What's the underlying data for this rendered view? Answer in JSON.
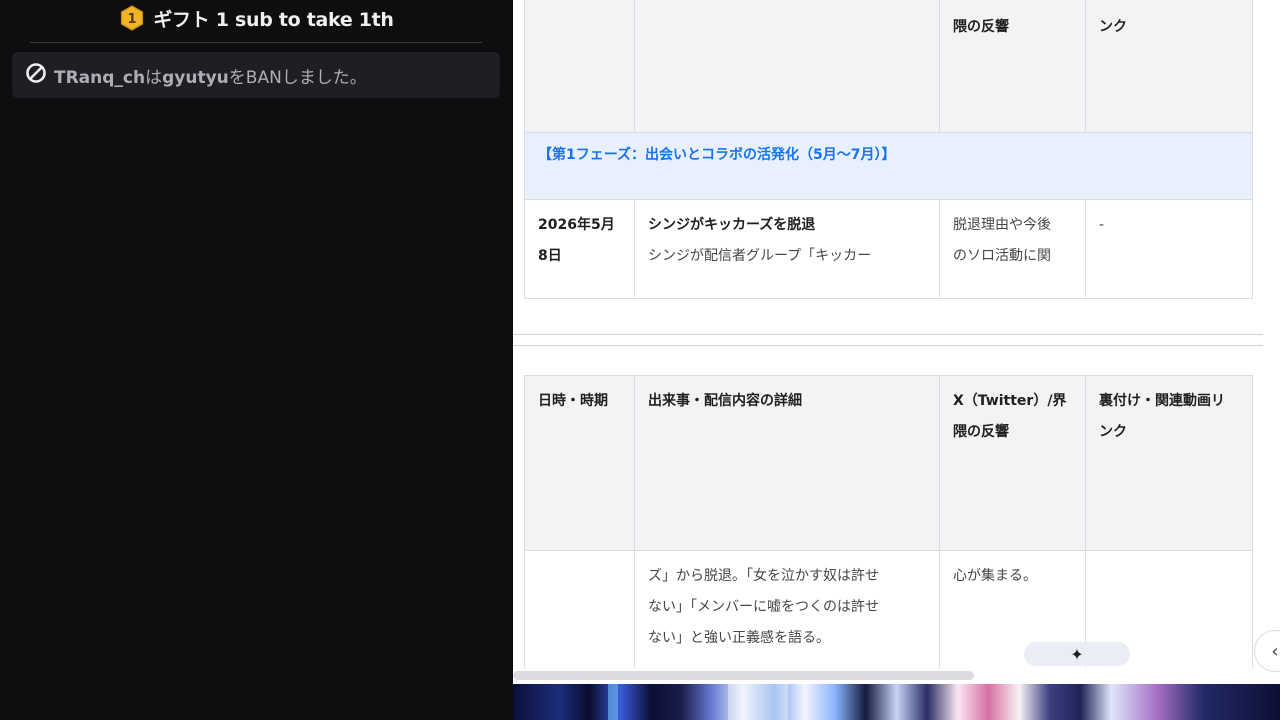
{
  "chat": {
    "gift": {
      "badge_number": "1",
      "text": "ギフト 1 sub to take 1th"
    },
    "ban": {
      "moderator": "TRanq_ch",
      "connector": "は",
      "target": "gyutyu",
      "suffix": "をBANしました。"
    }
  },
  "doc": {
    "table_top": {
      "header_partial": [
        "",
        "",
        "隈の反響",
        "ンク"
      ],
      "phase_label": "【第1フェーズ：出会いとコラボの活発化（5月〜7月）】",
      "row": {
        "date_line1": "2026年5月",
        "date_line2": "8日",
        "title": "シンジがキッカーズを脱退",
        "detail": "シンジが配信者グループ「キッカー",
        "reaction_line1": "脱退理由や今後",
        "reaction_line2": "のソロ活動に関",
        "link": "-"
      }
    },
    "table_bottom": {
      "headers": {
        "date": "日時・時期",
        "detail": "出来事・配信内容の詳細",
        "reaction_line1": "X（Twitter）/界",
        "reaction_line2": "隈の反響",
        "link_line1": "裏付け・関連動画リ",
        "link_line2": "ンク"
      },
      "row": {
        "date": "",
        "detail_line1": "ズ」から脱退。「女を泣かす奴は許せ",
        "detail_line2": "ない」「メンバーに嘘をつくのは許せ",
        "detail_line3": "ない」と強い正義感を語る。",
        "reaction": "心が集まる。",
        "link": ""
      }
    },
    "sparkle_icon": "sparkle-icon",
    "side_toggle_icon": "chevron-left-icon",
    "side_toggle_glyph": "‹",
    "sparkle_glyph": "✦"
  },
  "colors": {
    "chat_bg": "#0e0e10",
    "ban_bg": "#1f1f23",
    "phase_bg": "#e8f0fe",
    "phase_text": "#1a73e8",
    "header_bg": "#f1f3f4"
  }
}
